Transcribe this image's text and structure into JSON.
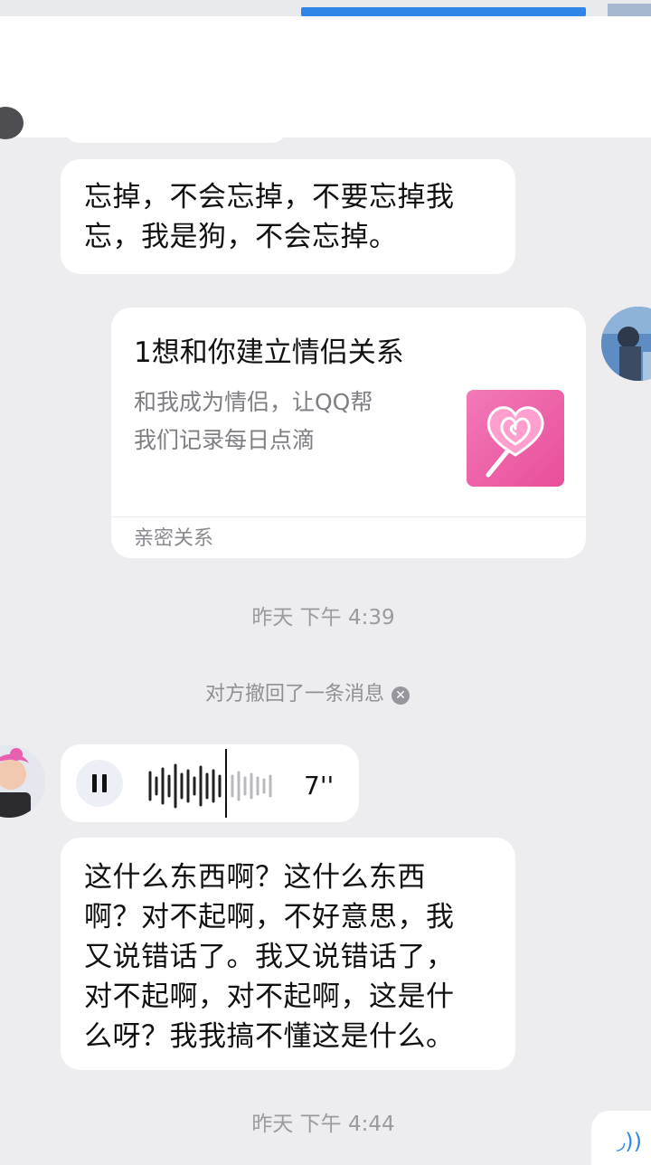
{
  "colors": {
    "background": "#ededf0",
    "bubble": "#ffffff",
    "accent": "#2f86e6",
    "card_thumb": "#ef5fa4",
    "muted_text": "#9a9aa0"
  },
  "messages": {
    "text1": {
      "line1": "忘掉，不会忘掉，不要忘掉我",
      "line2": "忘，我是狗，不会忘掉。"
    },
    "card": {
      "title": "1想和你建立情侣关系",
      "desc_line1": "和我成为情侣，让QQ帮",
      "desc_line2": "我们记录每日点滴",
      "footer": "亲密关系",
      "thumb_icon": "lollipop-icon"
    },
    "timestamp1": "昨天  下午 4:39",
    "recall": {
      "text": "对方撤回了一条消息",
      "icon": "close-icon"
    },
    "voice": {
      "duration": "7''",
      "state_icon": "pause-icon",
      "progress": 0.6
    },
    "text2": {
      "line1": "这什么东西啊？这什么东西",
      "line2": "啊？对不起啊，不好意思，我",
      "line3": "又说错话了。我又说错话了，",
      "line4": "对不起啊，对不起啊，这是什",
      "line5": "么呀？我我搞不懂这是什么。"
    },
    "timestamp2": "昨天  下午 4:44"
  }
}
